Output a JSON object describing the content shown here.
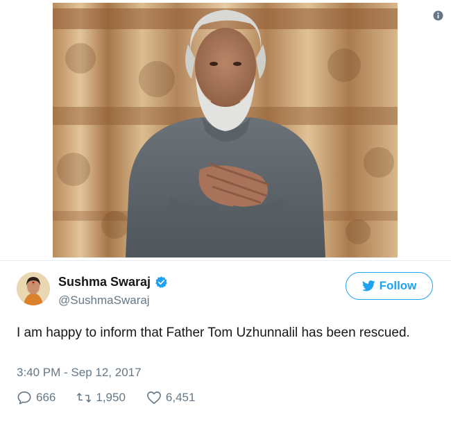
{
  "tweet": {
    "author": {
      "display_name": "Sushma Swaraj",
      "handle": "@SushmaSwaraj",
      "verified": true
    },
    "follow_label": "Follow",
    "text": "I am happy to inform that Father Tom Uzhunnalil has been rescued.",
    "timestamp": "3:40 PM - Sep 12, 2017",
    "stats": {
      "replies": "666",
      "retweets": "1,950",
      "likes": "6,451"
    }
  },
  "icons": {
    "info": "info-circle-icon",
    "verified": "verified-badge-icon",
    "follow": "twitter-bird-icon",
    "reply": "reply-bubble-icon",
    "retweet": "retweet-arrows-icon",
    "like": "heart-icon"
  },
  "colors": {
    "accent": "#1da1f2",
    "text_primary": "#14171a",
    "text_secondary": "#657786",
    "divider": "#e6ecf0"
  }
}
